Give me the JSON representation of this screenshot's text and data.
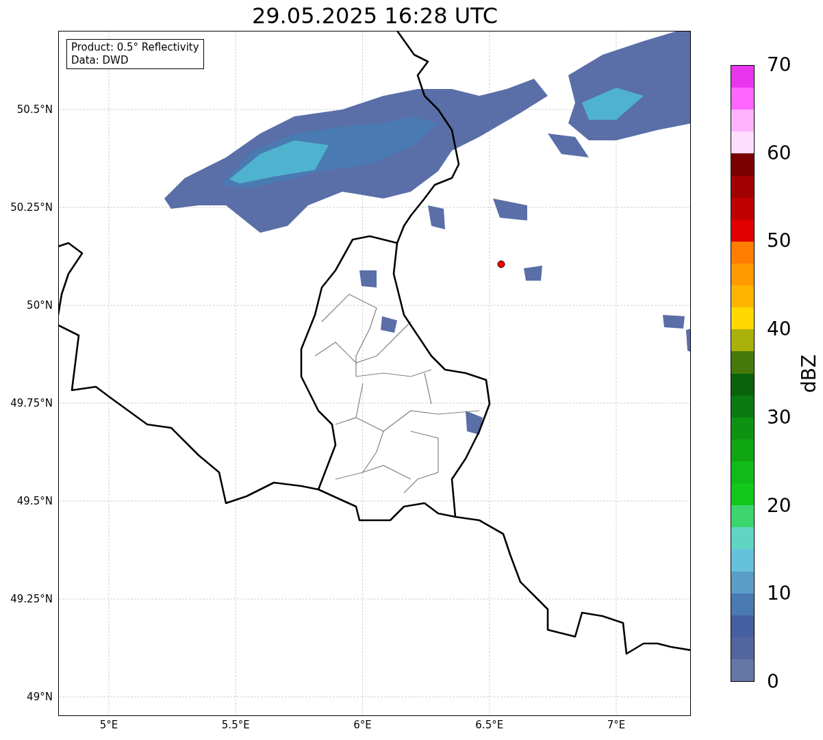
{
  "title": "29.05.2025 16:28 UTC",
  "legend": [
    "Product: 0.5° Reflectivity",
    "Data: DWD"
  ],
  "y_ticks": [
    "50.5°N",
    "50.25°N",
    "50°N",
    "49.75°N",
    "49.5°N",
    "49.25°N",
    "49°N"
  ],
  "x_ticks": [
    "5°E",
    "5.5°E",
    "6°E",
    "6.5°E",
    "7°E"
  ],
  "colorbar": {
    "ticks": [
      "70",
      "60",
      "50",
      "40",
      "30",
      "20",
      "10",
      "0"
    ],
    "segments": [
      {
        "color": "#e936ee"
      },
      {
        "color": "#ff66ff"
      },
      {
        "color": "#ffb3ff"
      },
      {
        "color": "#ffddff"
      },
      {
        "color": "#7a0000"
      },
      {
        "color": "#a00000"
      },
      {
        "color": "#c00000"
      },
      {
        "color": "#e00000"
      },
      {
        "color": "#ff7d00"
      },
      {
        "color": "#ff9900"
      },
      {
        "color": "#ffb500"
      },
      {
        "color": "#ffd800"
      },
      {
        "color": "#aab10a"
      },
      {
        "color": "#457a0a"
      },
      {
        "color": "#0a620c"
      },
      {
        "color": "#0a7a10"
      },
      {
        "color": "#0e9212"
      },
      {
        "color": "#0fa612"
      },
      {
        "color": "#10bb18"
      },
      {
        "color": "#12c81a"
      },
      {
        "color": "#3dd56e"
      },
      {
        "color": "#61d5c4"
      },
      {
        "color": "#66c1dc"
      },
      {
        "color": "#5a9ec8"
      },
      {
        "color": "#4a7ab2"
      },
      {
        "color": "#4560a0"
      },
      {
        "color": "#52669e"
      },
      {
        "color": "#6577a6"
      }
    ],
    "label": "dBZ"
  }
}
